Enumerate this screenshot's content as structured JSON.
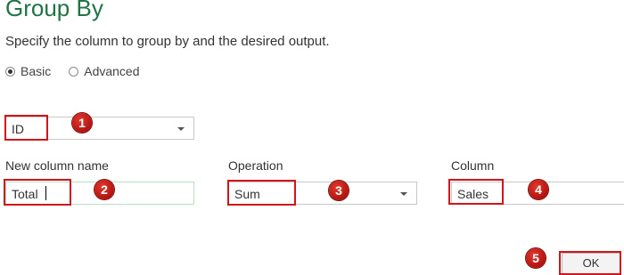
{
  "dialog": {
    "title": "Group By",
    "subtitle": "Specify the column to group by and the desired output."
  },
  "mode": {
    "basic_label": "Basic",
    "advanced_label": "Advanced",
    "selected": "Basic"
  },
  "group_by": {
    "value": "ID"
  },
  "new_column": {
    "label": "New column name",
    "value": "Total"
  },
  "operation": {
    "label": "Operation",
    "value": "Sum"
  },
  "column": {
    "label": "Column",
    "value": "Sales"
  },
  "ok_button": {
    "label": "OK"
  },
  "steps": [
    "1",
    "2",
    "3",
    "4",
    "5"
  ],
  "colors": {
    "title": "#217346",
    "annotation": "#d0151b",
    "badge": "#c0170f"
  }
}
